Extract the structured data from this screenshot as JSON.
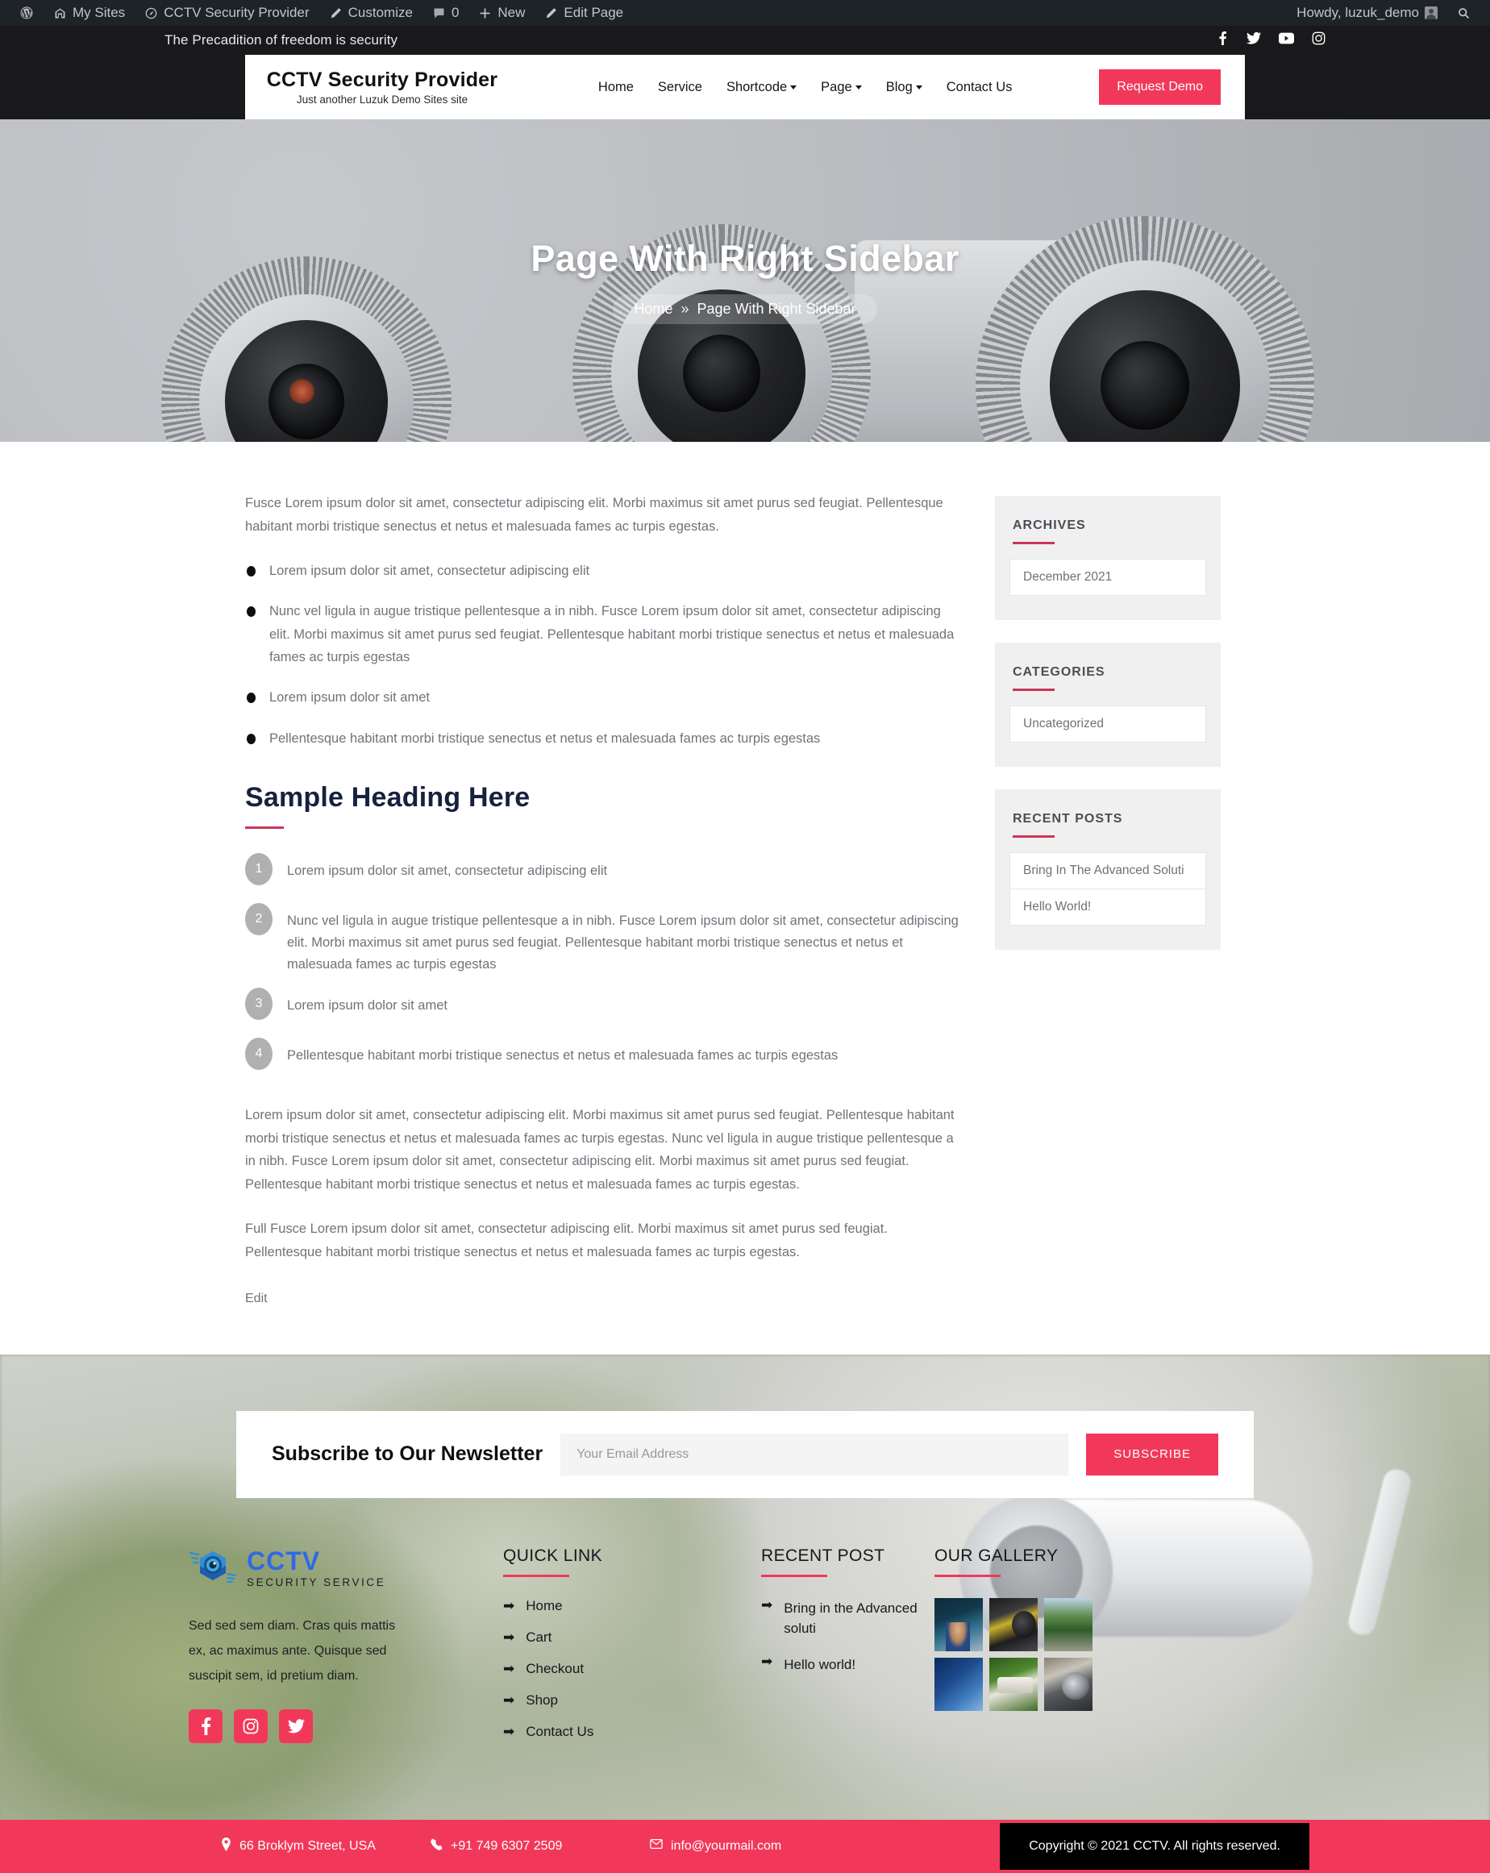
{
  "adminbar": {
    "items": [
      {
        "icon": "wordpress-icon",
        "label": ""
      },
      {
        "icon": "my-sites-icon",
        "label": "My Sites"
      },
      {
        "icon": "dashboard-icon",
        "label": "CCTV Security Provider"
      },
      {
        "icon": "customize-icon",
        "label": "Customize"
      },
      {
        "icon": "comments-icon",
        "label": "0"
      },
      {
        "icon": "new-icon",
        "label": "New"
      },
      {
        "icon": "edit-icon",
        "label": "Edit Page"
      }
    ],
    "howdy": "Howdy, luzuk_demo",
    "search_icon": "search-icon"
  },
  "topbar": {
    "tagline": "The Precadition of freedom is security",
    "social": [
      "facebook-icon",
      "twitter-icon",
      "youtube-icon",
      "instagram-icon"
    ]
  },
  "header": {
    "brand_title": "CCTV Security Provider",
    "brand_tagline": "Just another Luzuk Demo Sites site",
    "nav": [
      {
        "label": "Home",
        "has_dropdown": false
      },
      {
        "label": "Service",
        "has_dropdown": false
      },
      {
        "label": "Shortcode",
        "has_dropdown": true
      },
      {
        "label": "Page",
        "has_dropdown": true
      },
      {
        "label": "Blog",
        "has_dropdown": true
      },
      {
        "label": "Contact Us",
        "has_dropdown": false
      }
    ],
    "cta_label": "Request Demo"
  },
  "hero": {
    "title": "Page With Right Sidebar",
    "breadcrumb_home": "Home",
    "breadcrumb_sep": "»",
    "breadcrumb_current": "Page With Right Sidebar"
  },
  "main": {
    "intro": "Fusce Lorem ipsum dolor sit amet, consectetur adipiscing elit. Morbi maximus sit amet purus sed feugiat. Pellentesque habitant morbi tristique senectus et netus et malesuada fames ac turpis egestas.",
    "bullets": [
      "Lorem ipsum dolor sit amet, consectetur adipiscing elit",
      "Nunc vel ligula in augue tristique pellentesque a in nibh. Fusce Lorem ipsum dolor sit amet, consectetur adipiscing elit. Morbi maximus sit amet purus sed feugiat. Pellentesque habitant morbi tristique senectus et netus et malesuada fames ac turpis egestas",
      "Lorem ipsum dolor sit amet",
      "Pellentesque habitant morbi tristique senectus et netus et malesuada fames ac turpis egestas"
    ],
    "heading": "Sample Heading Here",
    "numbered": [
      {
        "n": "1",
        "text": "Lorem ipsum dolor sit amet, consectetur adipiscing elit"
      },
      {
        "n": "2",
        "text": "Nunc vel ligula in augue tristique pellentesque a in nibh. Fusce Lorem ipsum dolor sit amet, consectetur adipiscing elit. Morbi maximus sit amet purus sed feugiat. Pellentesque habitant morbi tristique senectus et netus et malesuada fames ac turpis egestas"
      },
      {
        "n": "3",
        "text": "Lorem ipsum dolor sit amet"
      },
      {
        "n": "4",
        "text": "Pellentesque habitant morbi tristique senectus et netus et malesuada fames ac turpis egestas"
      }
    ],
    "para2": "Lorem ipsum dolor sit amet, consectetur adipiscing elit. Morbi maximus sit amet purus sed feugiat. Pellentesque habitant morbi tristique senectus et netus et malesuada fames ac turpis egestas. Nunc vel ligula in augue tristique pellentesque a in nibh. Fusce Lorem ipsum dolor sit amet, consectetur adipiscing elit. Morbi maximus sit amet purus sed feugiat. Pellentesque habitant morbi tristique senectus et netus et malesuada fames ac turpis egestas.",
    "para3": "Full Fusce Lorem ipsum dolor sit amet, consectetur adipiscing elit. Morbi maximus sit amet purus sed feugiat. Pellentesque habitant morbi tristique senectus et netus et malesuada fames ac turpis egestas.",
    "edit_label": "Edit"
  },
  "sidebar": {
    "widgets": [
      {
        "title": "ARCHIVES",
        "items": [
          "December 2021"
        ]
      },
      {
        "title": "CATEGORIES",
        "items": [
          "Uncategorized"
        ]
      },
      {
        "title": "RECENT POSTS",
        "items": [
          "Bring In The Advanced Soluti",
          "Hello World!"
        ]
      }
    ]
  },
  "newsletter": {
    "title": "Subscribe to Our Newsletter",
    "placeholder": "Your Email Address",
    "value": "",
    "button": "SUBSCRIBE"
  },
  "footer": {
    "logo_main": "CCTV",
    "logo_sub": "SECURITY SERVICE",
    "about": "Sed sed sem diam. Cras quis mattis ex, ac maximus ante. Quisque sed suscipit sem, id pretium diam.",
    "social": [
      "facebook-icon",
      "instagram-icon",
      "twitter-icon"
    ],
    "quick_link_title": "QUICK LINK",
    "quick_links": [
      "Home",
      "Cart",
      "Checkout",
      "Shop",
      "Contact Us"
    ],
    "recent_post_title": "RECENT POST",
    "recent_posts": [
      "Bring in the Advanced soluti",
      "Hello world!"
    ],
    "gallery_title": "OUR GALLERY",
    "gallery": [
      "technician-server-photo",
      "cctv-tools-photo",
      "street-cameras-photo",
      "network-security-photo",
      "outdoor-camera-photo",
      "bullet-camera-photo"
    ],
    "arrow_glyph": "➡",
    "address": "66 Broklym Street, USA",
    "phone": "+91 749 6307 2509",
    "email": "info@yourmail.com",
    "copyright": "Copyright © 2021 CCTV. All rights reserved."
  },
  "colors": {
    "accent_pink": "#f2385a",
    "dark": "#19191c",
    "heading_navy": "#16213e",
    "muted_text": "#70737a",
    "widget_bg": "#f0f0f0",
    "logo_blue": "#2f6ae4"
  }
}
